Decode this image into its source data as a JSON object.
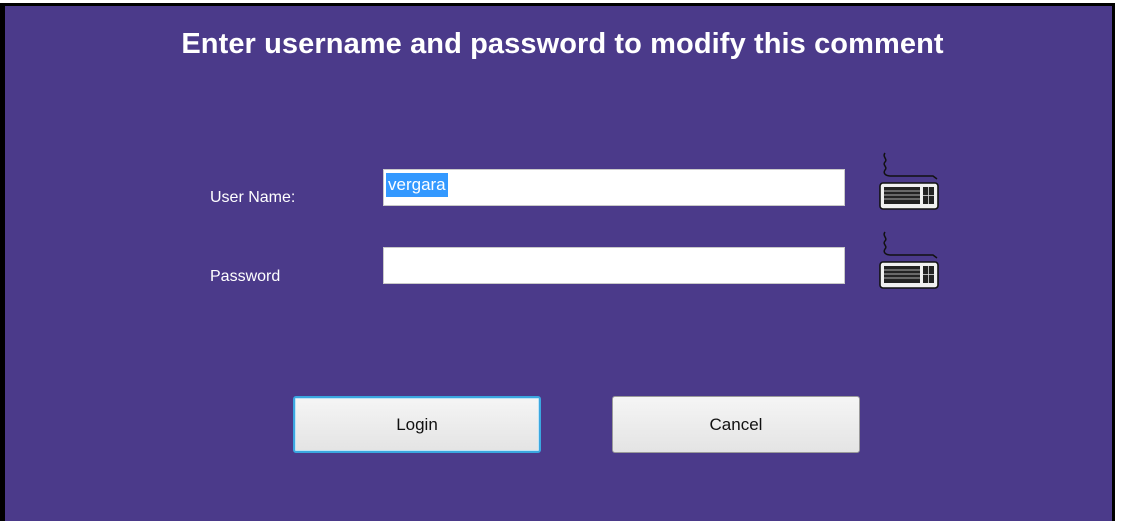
{
  "dialog": {
    "title": "Enter username and password to modify this comment"
  },
  "form": {
    "username": {
      "label": "User Name:",
      "value": "vergara"
    },
    "password": {
      "label": "Password",
      "value": ""
    }
  },
  "buttons": {
    "login_label": "Login",
    "cancel_label": "Cancel"
  },
  "icons": {
    "username_keyboard": "keyboard-icon",
    "password_keyboard": "keyboard-icon"
  },
  "colors": {
    "background": "#4b3a8a",
    "text": "#ffffff",
    "selection": "#3399ff",
    "focus_border": "#3ba7e0"
  }
}
